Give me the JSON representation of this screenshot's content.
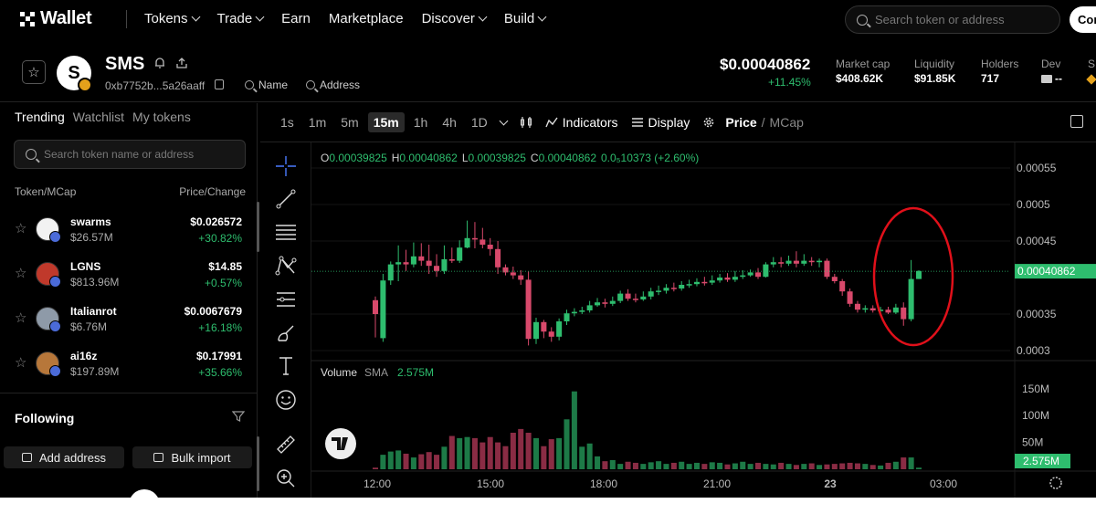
{
  "nav": {
    "logo_text": "Wallet",
    "items": [
      {
        "label": "Tokens",
        "chevron": true
      },
      {
        "label": "Trade",
        "chevron": true
      },
      {
        "label": "Earn",
        "chevron": false
      },
      {
        "label": "Marketplace",
        "chevron": false
      },
      {
        "label": "Discover",
        "chevron": true
      },
      {
        "label": "Build",
        "chevron": true
      }
    ],
    "search_placeholder": "Search token or address",
    "connect_label": "Connect"
  },
  "token": {
    "avatar_letter": "S",
    "name": "SMS",
    "address": "0xb7752b...5a26aaff",
    "name_search": "Name",
    "address_search": "Address",
    "price": "$0.00040862",
    "change": "+11.45%",
    "stats": [
      {
        "label": "Market cap",
        "value": "$408.62K"
      },
      {
        "label": "Liquidity",
        "value": "$91.85K"
      },
      {
        "label": "Holders",
        "value": "717"
      },
      {
        "label": "Dev",
        "value": "--"
      },
      {
        "label": "S",
        "value": ""
      }
    ]
  },
  "sidebar": {
    "tabs": [
      "Trending",
      "Watchlist",
      "My tokens"
    ],
    "search_placeholder": "Search token name or address",
    "col_left": "Token/MCap",
    "col_right": "Price/Change",
    "tokens": [
      {
        "name": "swarms",
        "mcap": "$26.57M",
        "price": "$0.026572",
        "change": "+30.82%",
        "avatar_color": "#f2f2f2"
      },
      {
        "name": "LGNS",
        "mcap": "$813.96M",
        "price": "$14.85",
        "change": "+0.57%",
        "avatar_color": "#c0392b"
      },
      {
        "name": "Italianrot",
        "mcap": "$6.76M",
        "price": "$0.0067679",
        "change": "+16.18%",
        "avatar_color": "#8e9aa8"
      },
      {
        "name": "ai16z",
        "mcap": "$197.89M",
        "price": "$0.17991",
        "change": "+35.66%",
        "avatar_color": "#b7773a"
      }
    ],
    "following": "Following",
    "add_address": "Add address",
    "bulk_import": "Bulk import"
  },
  "toolbar": {
    "timeframes": [
      "1s",
      "1m",
      "5m",
      "15m",
      "1h",
      "4h",
      "1D"
    ],
    "active_tf": "15m",
    "indicators": "Indicators",
    "display": "Display",
    "price": "Price",
    "mcap": "MCap"
  },
  "chart_data": {
    "type": "candlestick",
    "legend": {
      "o": "0.00039825",
      "h": "0.00040862",
      "l": "0.00039825",
      "c": "0.00040862",
      "change": "0.0₅10373 (+2.60%)"
    },
    "volume_label": "Volume",
    "sma_label": "SMA",
    "sma_value": "2.575M",
    "price_ticks": [
      "0.00055",
      "0.0005",
      "0.00045",
      "0.00035",
      "0.0003"
    ],
    "price_ylim": [
      0.00029,
      0.00056
    ],
    "current_price": "0.00040862",
    "current_price_value": 0.00040862,
    "volume_ticks": [
      "150M",
      "100M",
      "50M"
    ],
    "volume_ylim": [
      0,
      170
    ],
    "current_volume": "2.575M",
    "x_ticks": [
      {
        "label": "12:00",
        "bold": false,
        "pos": 0.085
      },
      {
        "label": "15:00",
        "bold": false,
        "pos": 0.245
      },
      {
        "label": "18:00",
        "bold": false,
        "pos": 0.405
      },
      {
        "label": "21:00",
        "bold": false,
        "pos": 0.565
      },
      {
        "label": "23",
        "bold": true,
        "pos": 0.725
      },
      {
        "label": "03:00",
        "bold": false,
        "pos": 0.885
      }
    ],
    "up_color": "#2ebd6e",
    "down_color": "#d8496b",
    "candles": [
      [
        0.000369,
        0.00035,
        0.000374,
        0.000318
      ],
      [
        0.000317,
        0.000396,
        0.000405,
        0.000312
      ],
      [
        0.000396,
        0.000418,
        0.000422,
        0.00039
      ],
      [
        0.000418,
        0.000421,
        0.000444,
        0.000395
      ],
      [
        0.000421,
        0.000418,
        0.000438,
        0.000409
      ],
      [
        0.000418,
        0.000429,
        0.000448,
        0.000414
      ],
      [
        0.000429,
        0.000423,
        0.000447,
        0.000416
      ],
      [
        0.000423,
        0.000416,
        0.000445,
        0.000405
      ],
      [
        0.000416,
        0.000409,
        0.000432,
        0.000401
      ],
      [
        0.000409,
        0.000425,
        0.000444,
        0.000405
      ],
      [
        0.000425,
        0.000423,
        0.000441,
        0.00042
      ],
      [
        0.000423,
        0.000441,
        0.000451,
        0.00042
      ],
      [
        0.000441,
        0.000454,
        0.000478,
        0.00044
      ],
      [
        0.000454,
        0.000452,
        0.000476,
        0.00044
      ],
      [
        0.000452,
        0.000445,
        0.000468,
        0.00044
      ],
      [
        0.000445,
        0.000439,
        0.000454,
        0.00043
      ],
      [
        0.000439,
        0.000414,
        0.00045,
        0.000405
      ],
      [
        0.000414,
        0.000407,
        0.000418,
        0.000403
      ],
      [
        0.000407,
        0.000403,
        0.000415,
        0.000398
      ],
      [
        0.000403,
        0.000397,
        0.00041,
        0.00039
      ],
      [
        0.000397,
        0.000316,
        0.000408,
        0.000307
      ],
      [
        0.000316,
        0.000339,
        0.000345,
        0.000309
      ],
      [
        0.000339,
        0.000326,
        0.000342,
        0.000317
      ],
      [
        0.000326,
        0.000319,
        0.000332,
        0.000312
      ],
      [
        0.000319,
        0.00034,
        0.000344,
        0.000314
      ],
      [
        0.00034,
        0.000351,
        0.000356,
        0.000335
      ],
      [
        0.000351,
        0.000353,
        0.000358,
        0.000347
      ],
      [
        0.000353,
        0.000355,
        0.00036,
        0.00035
      ],
      [
        0.000355,
        0.000362,
        0.000368,
        0.000352
      ],
      [
        0.000362,
        0.000366,
        0.000372,
        0.00036
      ],
      [
        0.000366,
        0.000364,
        0.000371,
        0.000359
      ],
      [
        0.000364,
        0.000368,
        0.000374,
        0.000361
      ],
      [
        0.000368,
        0.000378,
        0.000382,
        0.000365
      ],
      [
        0.000378,
        0.000371,
        0.000384,
        0.000368
      ],
      [
        0.000371,
        0.00037,
        0.000378,
        0.000366
      ],
      [
        0.00037,
        0.000374,
        0.000381,
        0.000368
      ],
      [
        0.000374,
        0.000381,
        0.000386,
        0.00037
      ],
      [
        0.000381,
        0.000382,
        0.000389,
        0.000376
      ],
      [
        0.000382,
        0.000386,
        0.000391,
        0.000378
      ],
      [
        0.000386,
        0.000385,
        0.000393,
        0.000381
      ],
      [
        0.000385,
        0.00039,
        0.000395,
        0.000382
      ],
      [
        0.00039,
        0.000391,
        0.000397,
        0.000386
      ],
      [
        0.000391,
        0.000394,
        0.000399,
        0.000388
      ],
      [
        0.000394,
        0.000393,
        0.000401,
        0.000389
      ],
      [
        0.000393,
        0.000396,
        0.000403,
        0.00039
      ],
      [
        0.000396,
        0.0004,
        0.000405,
        0.000393
      ],
      [
        0.0004,
        0.000397,
        0.000406,
        0.000394
      ],
      [
        0.000397,
        0.000401,
        0.000409,
        0.000394
      ],
      [
        0.000401,
        0.000403,
        0.00041,
        0.000398
      ],
      [
        0.000403,
        0.000407,
        0.000411,
        0.000401
      ],
      [
        0.000407,
        0.000401,
        0.000413,
        0.000398
      ],
      [
        0.000401,
        0.000418,
        0.000421,
        0.0004
      ],
      [
        0.000418,
        0.000421,
        0.000428,
        0.000414
      ],
      [
        0.000421,
        0.000419,
        0.000428,
        0.000414
      ],
      [
        0.000419,
        0.000423,
        0.00043,
        0.000416
      ],
      [
        0.000423,
        0.000419,
        0.000436,
        0.000414
      ],
      [
        0.000419,
        0.000423,
        0.000432,
        0.000416
      ],
      [
        0.000423,
        0.000421,
        0.000428,
        0.000416
      ],
      [
        0.000421,
        0.000423,
        0.000426,
        0.000414
      ],
      [
        0.000423,
        0.000401,
        0.000426,
        0.000398
      ],
      [
        0.000401,
        0.000395,
        0.000405,
        0.000392
      ],
      [
        0.000395,
        0.000381,
        0.000398,
        0.000375
      ],
      [
        0.000381,
        0.000364,
        0.000385,
        0.00036
      ],
      [
        0.000364,
        0.000356,
        0.000368,
        0.000352
      ],
      [
        0.000356,
        0.000358,
        0.000362,
        0.000352
      ],
      [
        0.000358,
        0.000355,
        0.000362,
        0.000352
      ],
      [
        0.000355,
        0.000356,
        0.00036,
        0.000352
      ],
      [
        0.000356,
        0.000352,
        0.00036,
        0.00035
      ],
      [
        0.000352,
        0.000359,
        0.000364,
        0.00035
      ],
      [
        0.000359,
        0.000343,
        0.000366,
        0.000334
      ],
      [
        0.000343,
        0.000398,
        0.000424,
        0.00034
      ],
      [
        0.000398,
        0.000409,
        0.00041,
        0.000398
      ]
    ],
    "volumes": [
      3,
      27,
      33,
      35,
      29,
      22,
      28,
      32,
      27,
      42,
      62,
      58,
      60,
      58,
      50,
      60,
      50,
      43,
      68,
      75,
      68,
      58,
      43,
      56,
      58,
      93,
      145,
      42,
      48,
      24,
      15,
      17,
      10,
      14,
      12,
      10,
      13,
      15,
      10,
      12,
      14,
      10,
      12,
      10,
      13,
      12,
      9,
      11,
      14,
      10,
      12,
      10,
      9,
      12,
      10,
      8,
      10,
      11,
      8,
      9,
      10,
      11,
      12,
      11,
      10,
      8,
      7,
      12,
      14,
      22,
      22,
      3
    ],
    "annotation": "red-ellipse"
  }
}
